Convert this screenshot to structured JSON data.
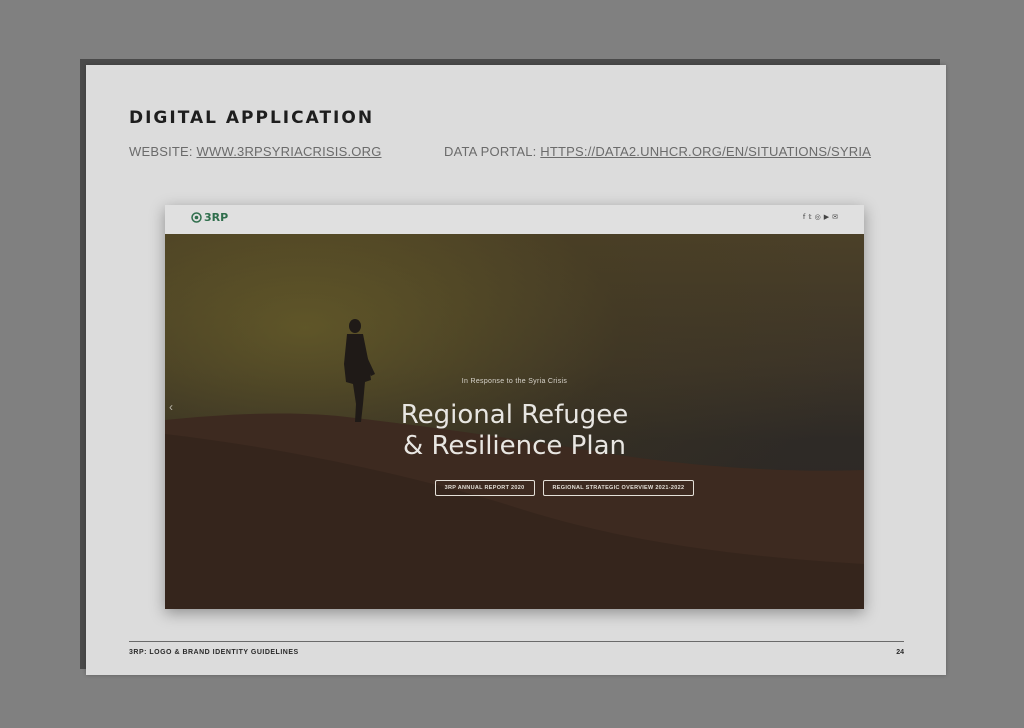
{
  "page": {
    "heading": "DIGITAL APPLICATION",
    "website_label": "WEBSITE:",
    "website_url": "WWW.3RPSYRIACRISIS.ORG",
    "portal_label": "DATA PORTAL:",
    "portal_url": "HTTPS://DATA2.UNHCR.ORG/EN/SITUATIONS/SYRIA"
  },
  "mockup": {
    "logo_text": "3RP",
    "social_icons": [
      "facebook-icon",
      "twitter-icon",
      "instagram-icon",
      "youtube-icon",
      "mail-icon"
    ],
    "social_glyphs": [
      "f",
      "𝕥",
      "◎",
      "▶",
      "✉"
    ],
    "kicker": "In Response to the Syria Crisis",
    "title_line1": "Regional Refugee",
    "title_line2": "& Resilience Plan",
    "button1": "3RP ANNUAL REPORT 2020",
    "button2": "REGIONAL STRATEGIC OVERVIEW 2021-2022",
    "prev_arrow": "‹"
  },
  "footer": {
    "title": "3RP: LOGO & BRAND IDENTITY GUIDELINES",
    "page_number": "24"
  },
  "colors": {
    "logo_green": "#2f6e4c",
    "background": "#808080",
    "page": "#dcdcdc"
  }
}
